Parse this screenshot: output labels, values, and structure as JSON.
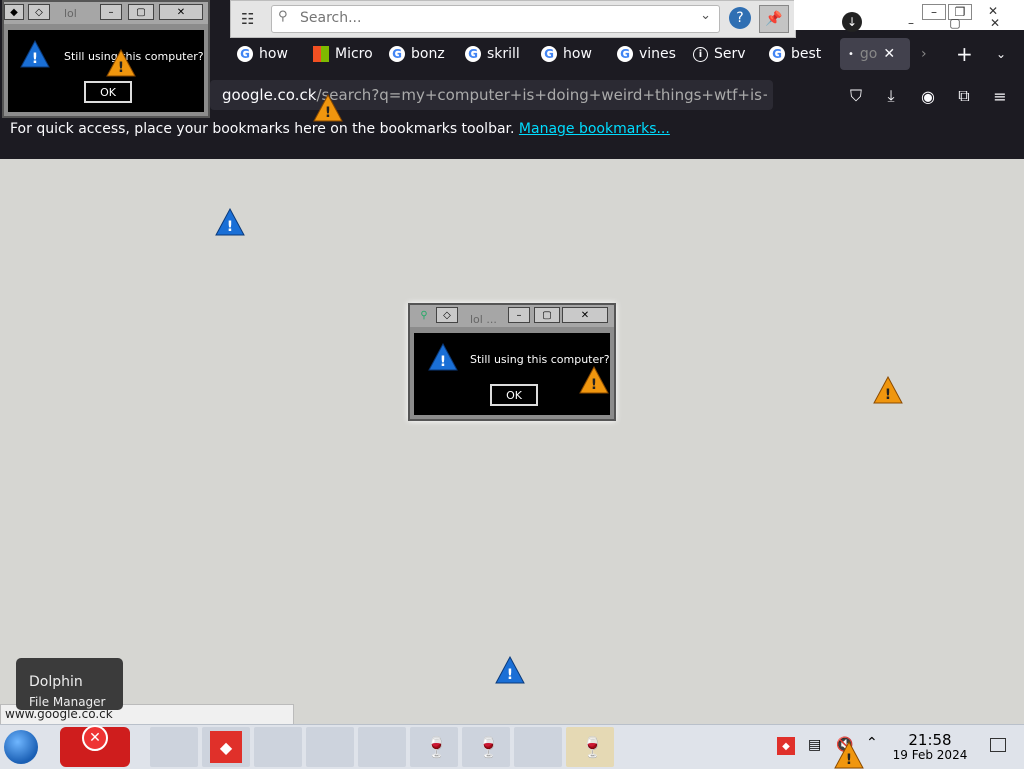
{
  "browser": {
    "tabs": [
      {
        "label": "how",
        "icon": "google-icon"
      },
      {
        "label": "Micro",
        "icon": "microsoft-icon"
      },
      {
        "label": "bonz",
        "icon": "google-icon"
      },
      {
        "label": "skrill",
        "icon": "google-icon"
      },
      {
        "label": "how",
        "icon": "google-icon"
      },
      {
        "label": "vines",
        "icon": "google-icon"
      },
      {
        "label": "Serv",
        "icon": "info-icon"
      },
      {
        "label": "best",
        "icon": "google-icon"
      },
      {
        "label": "go",
        "icon": "loading-icon"
      }
    ],
    "url_domain": "google.co.ck",
    "url_rest": "/search?q=my+computer+is+doing+weird+things+wtf+is+happ",
    "bookmarks_message": "For quick access, place your bookmarks here on the bookmarks toolbar.",
    "bookmarks_link": "Manage bookmarks..."
  },
  "search_toolbar": {
    "placeholder": "Search..."
  },
  "dialogs": {
    "top_left": {
      "title": "lol",
      "message": "Still using this computer?",
      "ok_label": "OK"
    },
    "center": {
      "title": "lol ...",
      "message": "Still using this computer?",
      "ok_label": "OK"
    }
  },
  "taskbar": {
    "tooltip_title": "Dolphin",
    "tooltip_subtitle": "File Manager",
    "status_url": "www.google.co.ck",
    "time": "21:58",
    "date": "19 Feb 2024"
  },
  "colors": {
    "accent_link": "#00ddff",
    "browser_bg": "#1c1b22",
    "desktop_bg": "#d6d6d2"
  }
}
